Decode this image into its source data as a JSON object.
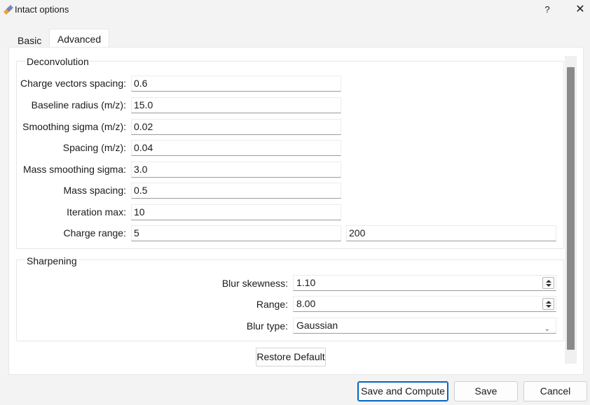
{
  "window": {
    "title": "Intact options",
    "help_label": "?",
    "close_label": "✕"
  },
  "tabs": [
    {
      "label": "Basic",
      "active": false
    },
    {
      "label": "Advanced",
      "active": true
    }
  ],
  "deconvolution": {
    "title": "Deconvolution",
    "fields": [
      {
        "label": "Charge vectors spacing:",
        "value": "0.6"
      },
      {
        "label": "Baseline radius (m/z):",
        "value": "15.0"
      },
      {
        "label": "Smoothing sigma (m/z):",
        "value": "0.02"
      },
      {
        "label": "Spacing (m/z):",
        "value": "0.04"
      },
      {
        "label": "Mass smoothing sigma:",
        "value": "3.0"
      },
      {
        "label": "Mass spacing:",
        "value": "0.5"
      },
      {
        "label": "Iteration max:",
        "value": "10"
      }
    ],
    "charge_range": {
      "label": "Charge range:",
      "min": "5",
      "max": "200"
    }
  },
  "sharpening": {
    "title": "Sharpening",
    "blur_skewness": {
      "label": "Blur skewness:",
      "value": "1.10"
    },
    "range": {
      "label": "Range:",
      "value": "8.00"
    },
    "blur_type": {
      "label": "Blur type:",
      "value": "Gaussian"
    }
  },
  "restore_default_label": "Restore Default",
  "buttons": {
    "save_and_compute": "Save and Compute",
    "save": "Save",
    "cancel": "Cancel"
  }
}
